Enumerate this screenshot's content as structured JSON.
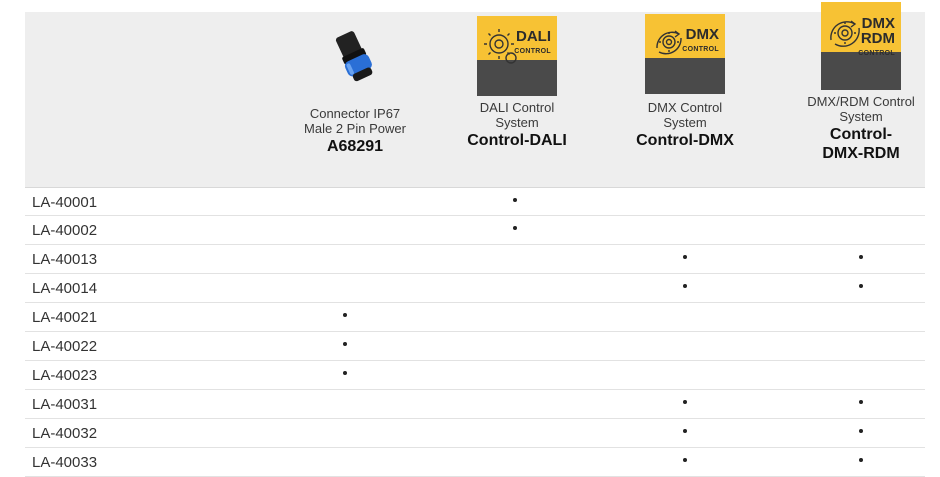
{
  "columns": [
    {
      "key": "connector",
      "name": "Connector IP67 Male 2 Pin Power",
      "code": "A68291",
      "image": "connector-product-image"
    },
    {
      "key": "dali",
      "name": "DALI Control System",
      "code": "Control-DALI",
      "badge": {
        "brand": "DALI",
        "sub": "CONTROL",
        "icon": "gear-icon"
      }
    },
    {
      "key": "dmx",
      "name": "DMX Control System",
      "code": "Control-DMX",
      "badge": {
        "brand": "DMX",
        "sub": "CONTROL",
        "icon": "gear-cycle-icon"
      }
    },
    {
      "key": "dmxrdm",
      "name": "DMX/RDM Control System",
      "code": "Control-DMX-RDM",
      "badge": {
        "brand": "DMX",
        "brand2": "RDM",
        "sub": "CONTROL",
        "icon": "gear-cycle-icon"
      }
    }
  ],
  "rows": [
    {
      "label": "LA-40001",
      "marks": [
        "dali"
      ]
    },
    {
      "label": "LA-40002",
      "marks": [
        "dali"
      ]
    },
    {
      "label": "LA-40013",
      "marks": [
        "dmx",
        "dmxrdm"
      ]
    },
    {
      "label": "LA-40014",
      "marks": [
        "dmx",
        "dmxrdm"
      ]
    },
    {
      "label": "LA-40021",
      "marks": [
        "connector"
      ]
    },
    {
      "label": "LA-40022",
      "marks": [
        "connector"
      ]
    },
    {
      "label": "LA-40023",
      "marks": [
        "connector"
      ]
    },
    {
      "label": "LA-40031",
      "marks": [
        "dmx",
        "dmxrdm"
      ]
    },
    {
      "label": "LA-40032",
      "marks": [
        "dmx",
        "dmxrdm"
      ]
    },
    {
      "label": "LA-40033",
      "marks": [
        "dmx",
        "dmxrdm"
      ]
    }
  ],
  "mark_symbol": "•",
  "colors": {
    "header_bg": "#eeeeee",
    "badge_yellow": "#f7c234",
    "badge_dark": "#4a4a4a",
    "connector_blue": "#2a6fd6"
  }
}
